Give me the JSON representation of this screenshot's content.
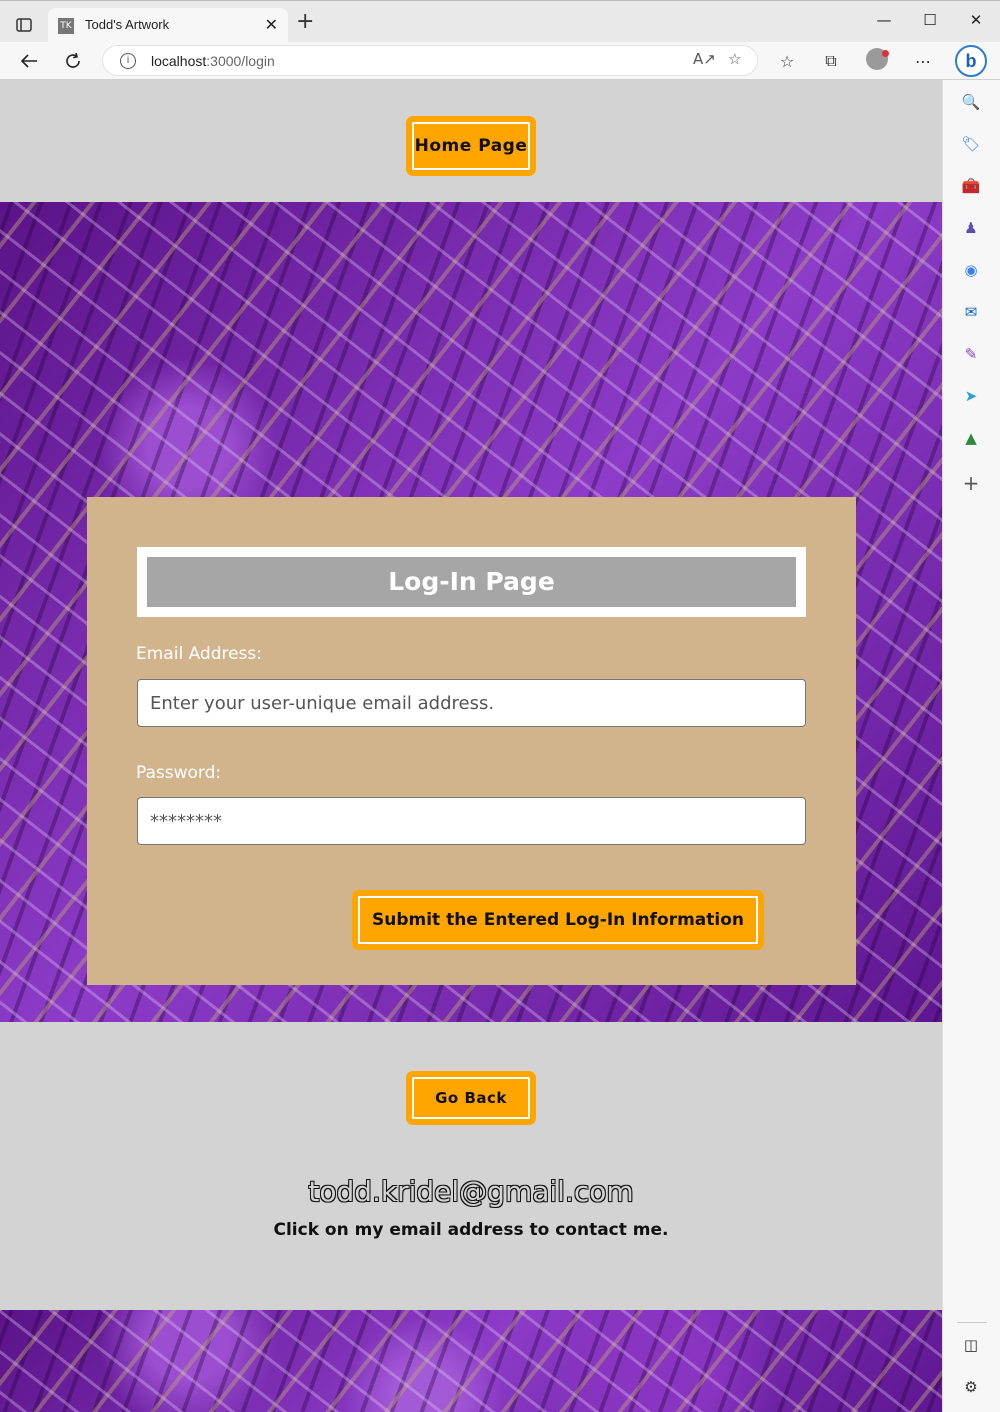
{
  "browser": {
    "tab_title": "Todd's Artwork",
    "tab_favicon_text": "TK",
    "url_host": "localhost",
    "url_rest": ":3000/login"
  },
  "header": {
    "home_button_label": "Home Page"
  },
  "login_form": {
    "title": "Log-In Page",
    "email_label": "Email Address:",
    "email_placeholder": "Enter your user-unique email address.",
    "password_label": "Password:",
    "password_placeholder": "********",
    "submit_label": "Submit the Entered Log-In Information"
  },
  "footer": {
    "go_back_label": "Go Back",
    "email": "todd.kridel@gmail.com",
    "contact_note": "Click on my email address to contact me."
  },
  "colors": {
    "button_orange": "#ffa500",
    "card_tan": "#d2b48c",
    "band_gray": "#d3d3d3",
    "title_gray": "#a6a6a6",
    "background_purple": "#6a1fa0"
  },
  "icons": {
    "toolbar": [
      "back-arrow-icon",
      "refresh-icon",
      "read-aloud-icon",
      "add-favorite-icon",
      "favorites-icon",
      "collections-icon",
      "profile-icon",
      "more-icon",
      "bing-chat-icon"
    ],
    "sidebar": [
      "search-icon",
      "shopping-tag-icon",
      "tools-icon",
      "games-icon",
      "microsoft-365-icon",
      "outlook-icon",
      "designer-icon",
      "send-icon",
      "tree-icon",
      "add-icon",
      "split-screen-icon",
      "settings-icon"
    ]
  }
}
